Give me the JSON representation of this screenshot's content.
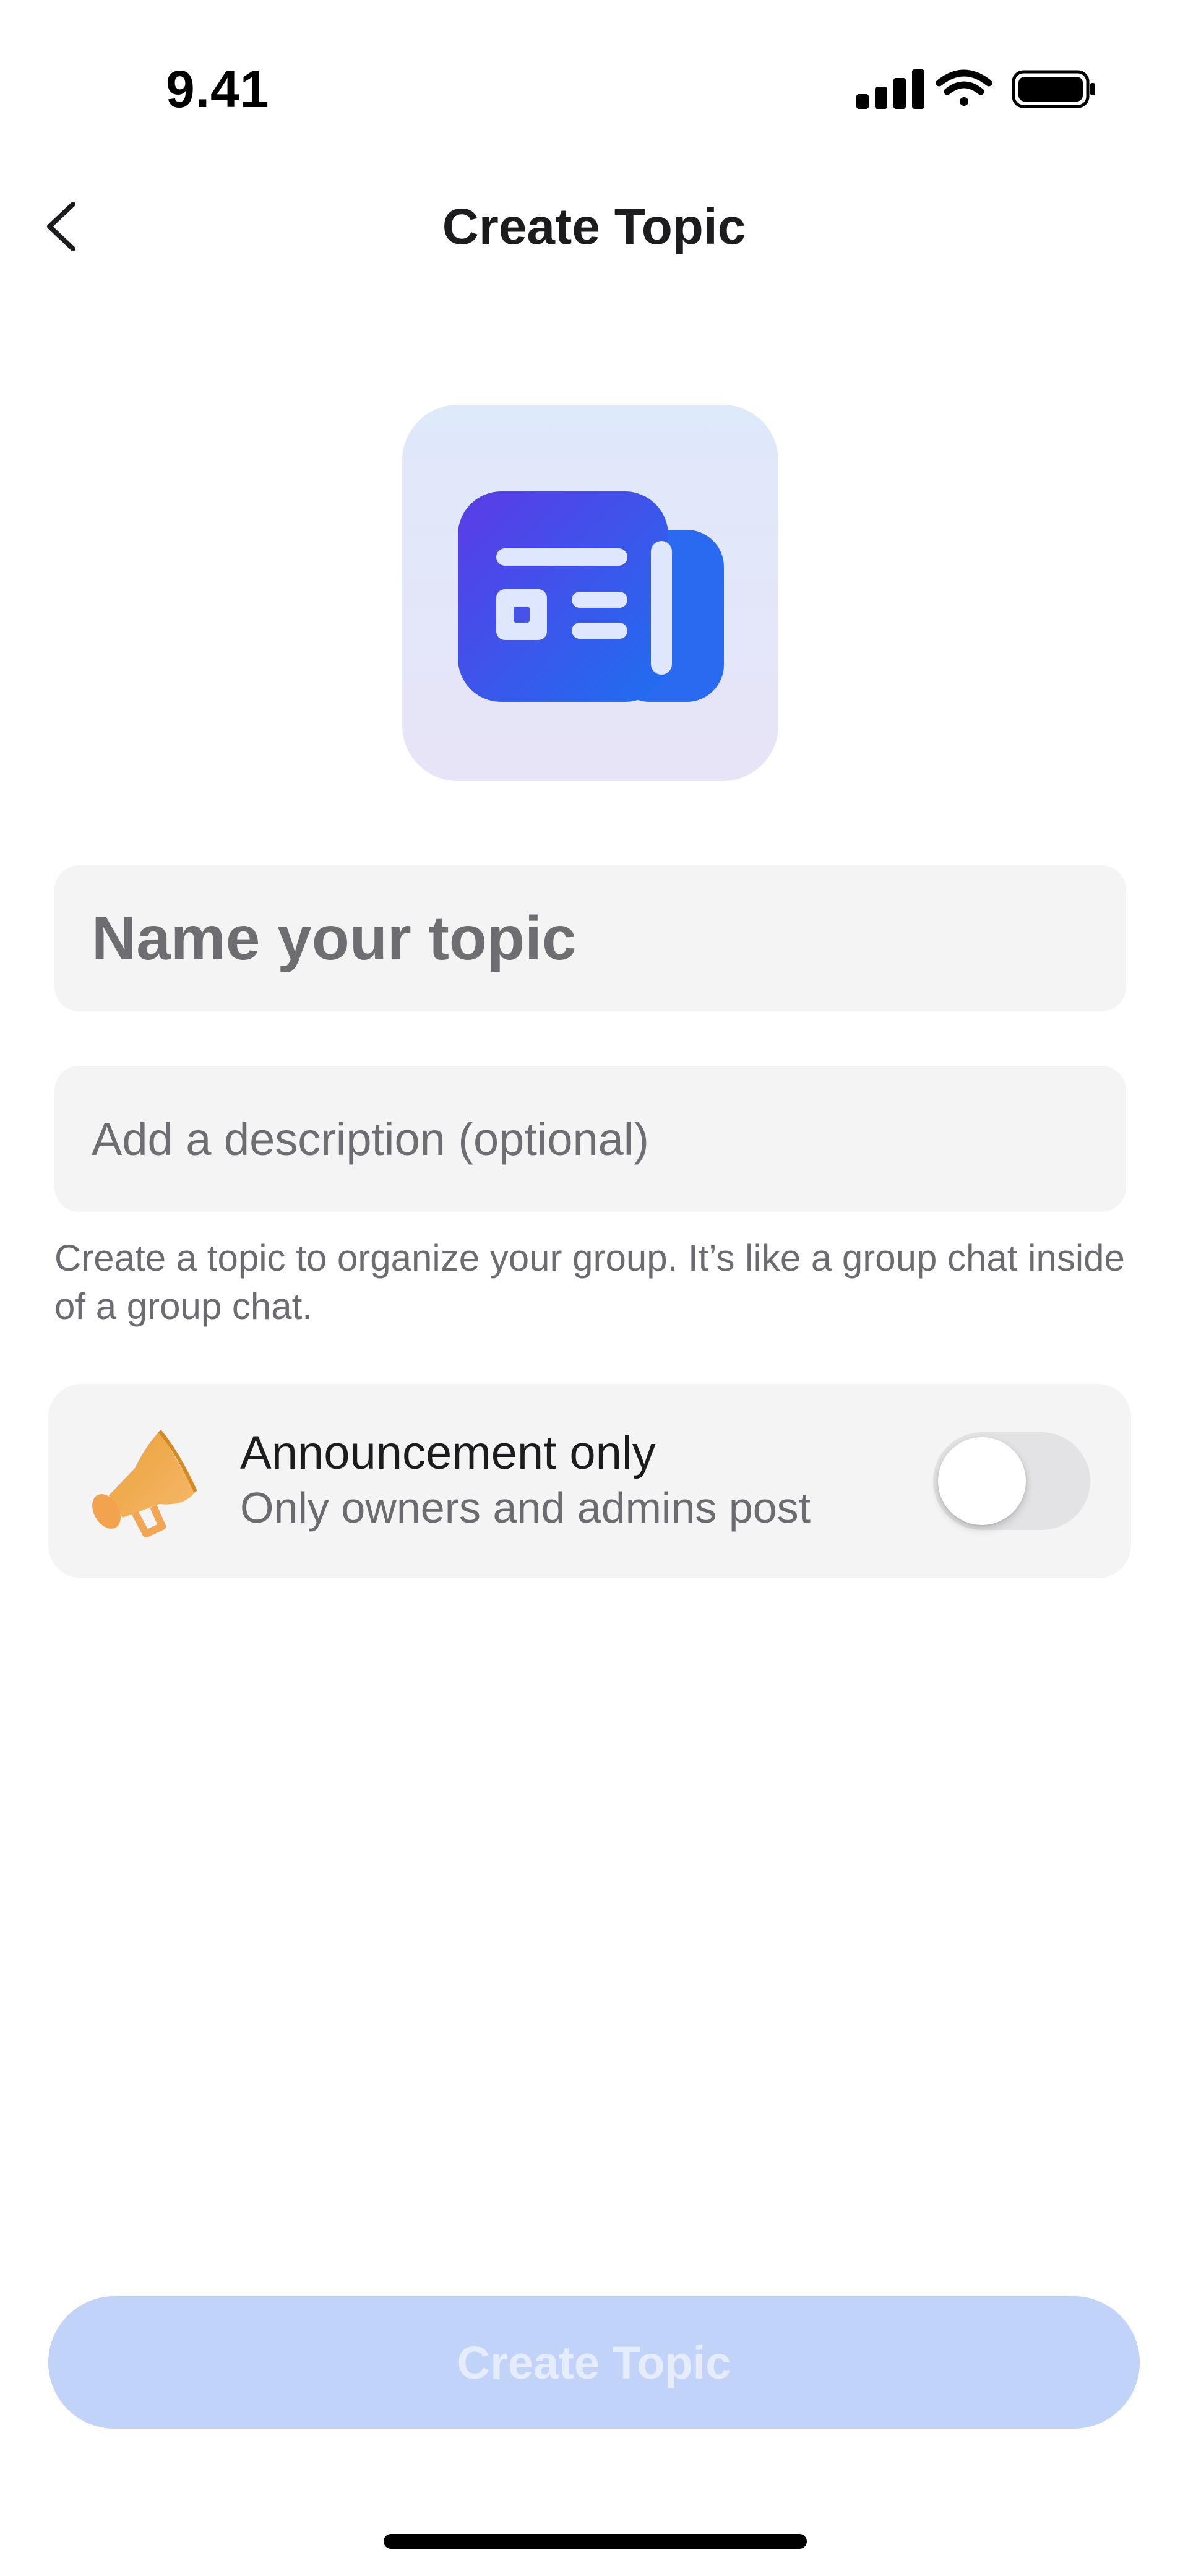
{
  "status_bar": {
    "time": "9.41",
    "icons": [
      "cellular-signal-icon",
      "wifi-icon",
      "battery-icon"
    ]
  },
  "header": {
    "back_icon": "chevron-left-icon",
    "title": "Create Topic"
  },
  "topic_icon": {
    "icon": "newspaper-icon",
    "colors": {
      "tile_top": "#dee9fa",
      "tile_bottom": "#e8e4f8",
      "glyph_start": "#5b3be6",
      "glyph_end": "#1e6ff0"
    }
  },
  "form": {
    "name_value": "",
    "name_placeholder": "Name your topic",
    "description_value": "",
    "description_placeholder": "Add a description (optional)",
    "helper_text": "Create a topic to organize your group. It’s like a group chat inside of a group chat."
  },
  "announcement": {
    "icon": "megaphone-icon",
    "title": "Announcement only",
    "subtitle": "Only owners and admins post",
    "enabled": false
  },
  "footer": {
    "create_label": "Create Topic",
    "button_color": "#c2d3fa",
    "disabled": true
  }
}
